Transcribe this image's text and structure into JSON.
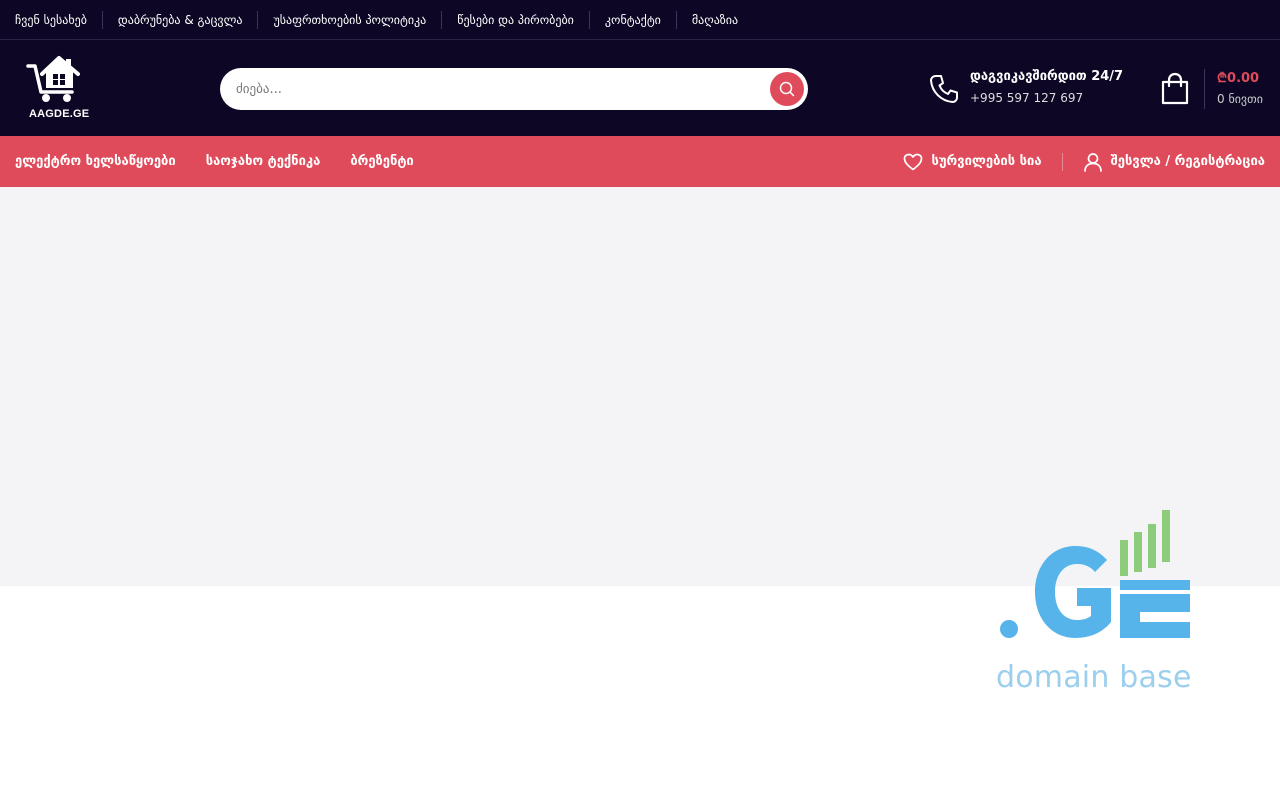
{
  "topbar": {
    "links": [
      "ჩვენ სესახებ",
      "დაბრუნება & გაცვლა",
      "უსაფრთხოების პოლიტიკა",
      "წესები და პირობები",
      "კონტაქტი",
      "მაღაზია"
    ]
  },
  "logo": {
    "text": "AAGDE.GE"
  },
  "search": {
    "placeholder": "ძიება..."
  },
  "contact": {
    "title": "დაგვიკავშირდით 24/7",
    "phone": "+995 597 127 697"
  },
  "cart": {
    "amount": "₾0.00",
    "count": "0 ნივთი"
  },
  "nav": {
    "categories": [
      "ელექტრო ხელსაწყოები",
      "საოჯახო ტექნიკა",
      "ბრეზენტი"
    ],
    "wishlist": "სურვილების სია",
    "login": "შესვლა / რეგისტრაცია"
  },
  "watermark": {
    "brand": ".GE",
    "subtitle": "domain base"
  },
  "colors": {
    "dark": "#0d0725",
    "accent": "#e04b5b",
    "hero": "#f4f4f6",
    "wm_blue": "#56b4ea",
    "wm_green": "#8ccc7a"
  },
  "icons": [
    "house-cart-logo-icon",
    "search-icon",
    "phone-icon",
    "shopping-bag-icon",
    "heart-icon",
    "user-icon"
  ]
}
